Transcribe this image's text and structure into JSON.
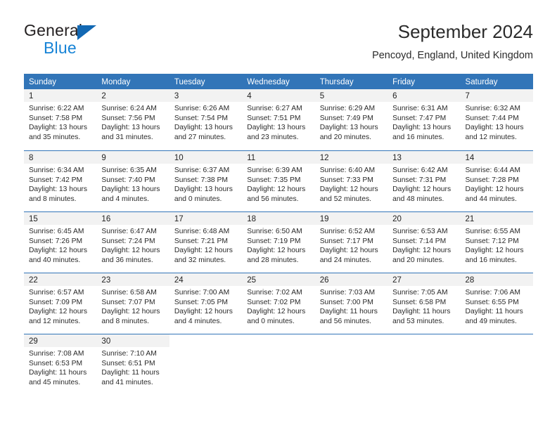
{
  "brand": {
    "name_top": "General",
    "name_bottom": "Blue",
    "triangle_color": "#1268b3",
    "blue_color": "#1683d6"
  },
  "header": {
    "title": "September 2024",
    "subtitle": "Pencoyd, England, United Kingdom"
  },
  "theme": {
    "header_blue": "#3275b8",
    "daynum_band": "#f2f2f2",
    "text": "#2a2a2a"
  },
  "weekdays": [
    "Sunday",
    "Monday",
    "Tuesday",
    "Wednesday",
    "Thursday",
    "Friday",
    "Saturday"
  ],
  "weeks": [
    [
      {
        "day": "1",
        "sunrise": "Sunrise: 6:22 AM",
        "sunset": "Sunset: 7:58 PM",
        "daylight_1": "Daylight: 13 hours",
        "daylight_2": "and 35 minutes."
      },
      {
        "day": "2",
        "sunrise": "Sunrise: 6:24 AM",
        "sunset": "Sunset: 7:56 PM",
        "daylight_1": "Daylight: 13 hours",
        "daylight_2": "and 31 minutes."
      },
      {
        "day": "3",
        "sunrise": "Sunrise: 6:26 AM",
        "sunset": "Sunset: 7:54 PM",
        "daylight_1": "Daylight: 13 hours",
        "daylight_2": "and 27 minutes."
      },
      {
        "day": "4",
        "sunrise": "Sunrise: 6:27 AM",
        "sunset": "Sunset: 7:51 PM",
        "daylight_1": "Daylight: 13 hours",
        "daylight_2": "and 23 minutes."
      },
      {
        "day": "5",
        "sunrise": "Sunrise: 6:29 AM",
        "sunset": "Sunset: 7:49 PM",
        "daylight_1": "Daylight: 13 hours",
        "daylight_2": "and 20 minutes."
      },
      {
        "day": "6",
        "sunrise": "Sunrise: 6:31 AM",
        "sunset": "Sunset: 7:47 PM",
        "daylight_1": "Daylight: 13 hours",
        "daylight_2": "and 16 minutes."
      },
      {
        "day": "7",
        "sunrise": "Sunrise: 6:32 AM",
        "sunset": "Sunset: 7:44 PM",
        "daylight_1": "Daylight: 13 hours",
        "daylight_2": "and 12 minutes."
      }
    ],
    [
      {
        "day": "8",
        "sunrise": "Sunrise: 6:34 AM",
        "sunset": "Sunset: 7:42 PM",
        "daylight_1": "Daylight: 13 hours",
        "daylight_2": "and 8 minutes."
      },
      {
        "day": "9",
        "sunrise": "Sunrise: 6:35 AM",
        "sunset": "Sunset: 7:40 PM",
        "daylight_1": "Daylight: 13 hours",
        "daylight_2": "and 4 minutes."
      },
      {
        "day": "10",
        "sunrise": "Sunrise: 6:37 AM",
        "sunset": "Sunset: 7:38 PM",
        "daylight_1": "Daylight: 13 hours",
        "daylight_2": "and 0 minutes."
      },
      {
        "day": "11",
        "sunrise": "Sunrise: 6:39 AM",
        "sunset": "Sunset: 7:35 PM",
        "daylight_1": "Daylight: 12 hours",
        "daylight_2": "and 56 minutes."
      },
      {
        "day": "12",
        "sunrise": "Sunrise: 6:40 AM",
        "sunset": "Sunset: 7:33 PM",
        "daylight_1": "Daylight: 12 hours",
        "daylight_2": "and 52 minutes."
      },
      {
        "day": "13",
        "sunrise": "Sunrise: 6:42 AM",
        "sunset": "Sunset: 7:31 PM",
        "daylight_1": "Daylight: 12 hours",
        "daylight_2": "and 48 minutes."
      },
      {
        "day": "14",
        "sunrise": "Sunrise: 6:44 AM",
        "sunset": "Sunset: 7:28 PM",
        "daylight_1": "Daylight: 12 hours",
        "daylight_2": "and 44 minutes."
      }
    ],
    [
      {
        "day": "15",
        "sunrise": "Sunrise: 6:45 AM",
        "sunset": "Sunset: 7:26 PM",
        "daylight_1": "Daylight: 12 hours",
        "daylight_2": "and 40 minutes."
      },
      {
        "day": "16",
        "sunrise": "Sunrise: 6:47 AM",
        "sunset": "Sunset: 7:24 PM",
        "daylight_1": "Daylight: 12 hours",
        "daylight_2": "and 36 minutes."
      },
      {
        "day": "17",
        "sunrise": "Sunrise: 6:48 AM",
        "sunset": "Sunset: 7:21 PM",
        "daylight_1": "Daylight: 12 hours",
        "daylight_2": "and 32 minutes."
      },
      {
        "day": "18",
        "sunrise": "Sunrise: 6:50 AM",
        "sunset": "Sunset: 7:19 PM",
        "daylight_1": "Daylight: 12 hours",
        "daylight_2": "and 28 minutes."
      },
      {
        "day": "19",
        "sunrise": "Sunrise: 6:52 AM",
        "sunset": "Sunset: 7:17 PM",
        "daylight_1": "Daylight: 12 hours",
        "daylight_2": "and 24 minutes."
      },
      {
        "day": "20",
        "sunrise": "Sunrise: 6:53 AM",
        "sunset": "Sunset: 7:14 PM",
        "daylight_1": "Daylight: 12 hours",
        "daylight_2": "and 20 minutes."
      },
      {
        "day": "21",
        "sunrise": "Sunrise: 6:55 AM",
        "sunset": "Sunset: 7:12 PM",
        "daylight_1": "Daylight: 12 hours",
        "daylight_2": "and 16 minutes."
      }
    ],
    [
      {
        "day": "22",
        "sunrise": "Sunrise: 6:57 AM",
        "sunset": "Sunset: 7:09 PM",
        "daylight_1": "Daylight: 12 hours",
        "daylight_2": "and 12 minutes."
      },
      {
        "day": "23",
        "sunrise": "Sunrise: 6:58 AM",
        "sunset": "Sunset: 7:07 PM",
        "daylight_1": "Daylight: 12 hours",
        "daylight_2": "and 8 minutes."
      },
      {
        "day": "24",
        "sunrise": "Sunrise: 7:00 AM",
        "sunset": "Sunset: 7:05 PM",
        "daylight_1": "Daylight: 12 hours",
        "daylight_2": "and 4 minutes."
      },
      {
        "day": "25",
        "sunrise": "Sunrise: 7:02 AM",
        "sunset": "Sunset: 7:02 PM",
        "daylight_1": "Daylight: 12 hours",
        "daylight_2": "and 0 minutes."
      },
      {
        "day": "26",
        "sunrise": "Sunrise: 7:03 AM",
        "sunset": "Sunset: 7:00 PM",
        "daylight_1": "Daylight: 11 hours",
        "daylight_2": "and 56 minutes."
      },
      {
        "day": "27",
        "sunrise": "Sunrise: 7:05 AM",
        "sunset": "Sunset: 6:58 PM",
        "daylight_1": "Daylight: 11 hours",
        "daylight_2": "and 53 minutes."
      },
      {
        "day": "28",
        "sunrise": "Sunrise: 7:06 AM",
        "sunset": "Sunset: 6:55 PM",
        "daylight_1": "Daylight: 11 hours",
        "daylight_2": "and 49 minutes."
      }
    ],
    [
      {
        "day": "29",
        "sunrise": "Sunrise: 7:08 AM",
        "sunset": "Sunset: 6:53 PM",
        "daylight_1": "Daylight: 11 hours",
        "daylight_2": "and 45 minutes."
      },
      {
        "day": "30",
        "sunrise": "Sunrise: 7:10 AM",
        "sunset": "Sunset: 6:51 PM",
        "daylight_1": "Daylight: 11 hours",
        "daylight_2": "and 41 minutes."
      },
      {
        "day": "",
        "sunrise": "",
        "sunset": "",
        "daylight_1": "",
        "daylight_2": ""
      },
      {
        "day": "",
        "sunrise": "",
        "sunset": "",
        "daylight_1": "",
        "daylight_2": ""
      },
      {
        "day": "",
        "sunrise": "",
        "sunset": "",
        "daylight_1": "",
        "daylight_2": ""
      },
      {
        "day": "",
        "sunrise": "",
        "sunset": "",
        "daylight_1": "",
        "daylight_2": ""
      },
      {
        "day": "",
        "sunrise": "",
        "sunset": "",
        "daylight_1": "",
        "daylight_2": ""
      }
    ]
  ]
}
